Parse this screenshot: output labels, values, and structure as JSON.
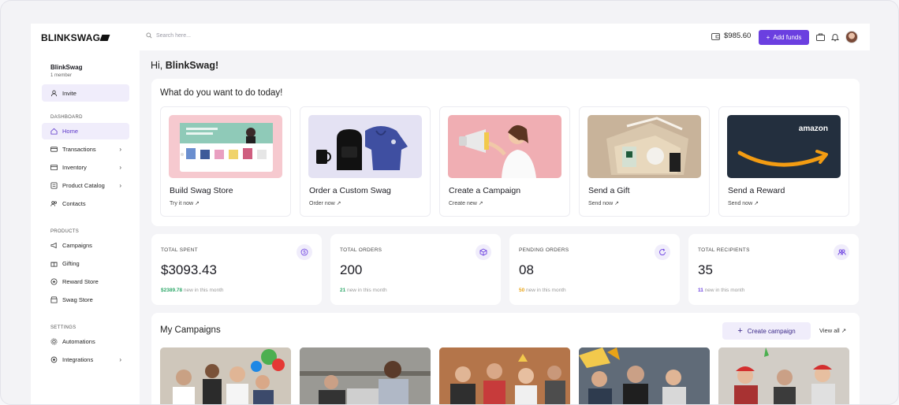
{
  "topbar": {
    "logo": "BLINKSWAG",
    "search_placeholder": "Search here...",
    "balance": "$985.60",
    "add_funds_label": "Add funds"
  },
  "sidebar": {
    "org_name": "BlinkSwag",
    "org_members": "1 member",
    "invite_label": "Invite",
    "dashboard_title": "DASHBOARD",
    "dashboard_items": [
      {
        "label": "Home",
        "icon": "home-icon",
        "active": true
      },
      {
        "label": "Transactions",
        "icon": "card-icon",
        "chevron": true
      },
      {
        "label": "Inventory",
        "icon": "box-icon",
        "chevron": true
      },
      {
        "label": "Product Catalog",
        "icon": "catalog-icon",
        "chevron": true
      },
      {
        "label": "Contacts",
        "icon": "contacts-icon"
      }
    ],
    "products_title": "PRODUCTS",
    "product_items": [
      {
        "label": "Campaigns",
        "icon": "megaphone-icon"
      },
      {
        "label": "Gifting",
        "icon": "gift-icon"
      },
      {
        "label": "Reward Store",
        "icon": "reward-icon"
      },
      {
        "label": "Swag Store",
        "icon": "store-icon"
      }
    ],
    "settings_title": "SETTINGS",
    "settings_items": [
      {
        "label": "Automations",
        "icon": "automation-icon"
      },
      {
        "label": "Integrations",
        "icon": "integration-icon",
        "chevron": true
      }
    ]
  },
  "main": {
    "greeting_prefix": "Hi, ",
    "greeting_name": "BlinkSwag!",
    "todo_title": "What do you want to do today!",
    "actions": [
      {
        "title": "Build Swag Store",
        "link": "Try it now"
      },
      {
        "title": "Order a Custom Swag",
        "link": "Order now"
      },
      {
        "title": "Create a Campaign",
        "link": "Create new"
      },
      {
        "title": "Send a Gift",
        "link": "Send now"
      },
      {
        "title": "Send a Reward",
        "link": "Send now"
      }
    ],
    "reward_brand": "amazon",
    "stats": [
      {
        "label": "TOTAL SPENT",
        "value": "$3093.43",
        "note_value": "$2389.78",
        "note_text": " new in this month",
        "note_color": "#2fa86a",
        "icon": "dollar-icon"
      },
      {
        "label": "TOTAL ORDERS",
        "value": "200",
        "note_value": "21",
        "note_text": " new in this month",
        "note_color": "#2fa86a",
        "icon": "package-icon"
      },
      {
        "label": "PENDING ORDERS",
        "value": "08",
        "note_value": "50",
        "note_text": " new in this month",
        "note_color": "#e8a317",
        "icon": "refresh-icon"
      },
      {
        "label": "TOTAL RECIPIENTS",
        "value": "35",
        "note_value": "11",
        "note_text": " new in this month",
        "note_color": "#6b3fe0",
        "icon": "users-icon"
      }
    ],
    "campaigns_title": "My Campaigns",
    "create_campaign_label": "Create campaign",
    "view_all_label": "View all"
  },
  "colors": {
    "accent": "#6b3fe0",
    "accent_soft": "#f0edfb"
  }
}
